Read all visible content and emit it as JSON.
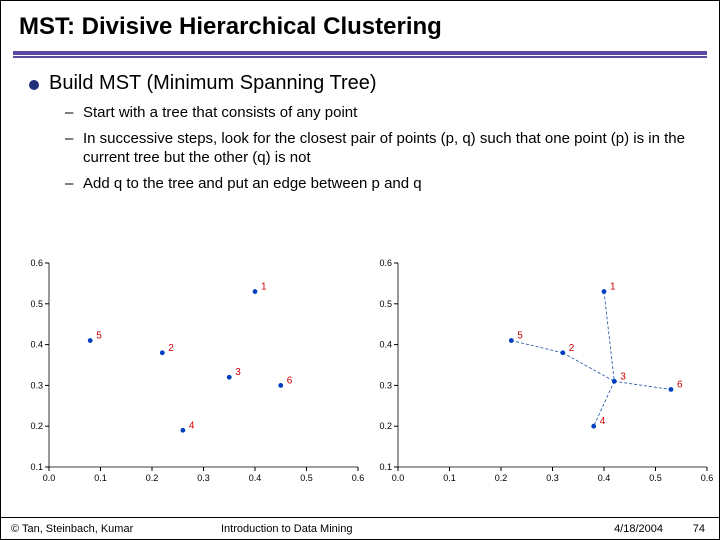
{
  "title": "MST: Divisive Hierarchical Clustering",
  "main_bullet": "Build MST (Minimum Spanning Tree)",
  "sub_bullets": [
    "Start with a tree that consists of any point",
    "In successive steps, look for the closest pair of points (p, q)  such that one point (p) is in the current tree but the other (q) is not",
    "Add q to the tree and put an edge between p and q"
  ],
  "chart_data": [
    {
      "type": "scatter",
      "title": "",
      "xlabel": "",
      "ylabel": "",
      "xlim": [
        0,
        0.6
      ],
      "ylim": [
        0.1,
        0.6
      ],
      "xticks": [
        0,
        0.1,
        0.2,
        0.3,
        0.4,
        0.5,
        0.6
      ],
      "yticks": [
        0.1,
        0.2,
        0.3,
        0.4,
        0.5,
        0.6
      ],
      "series": [
        {
          "name": "points",
          "points": [
            {
              "label": "1",
              "x": 0.4,
              "y": 0.53
            },
            {
              "label": "2",
              "x": 0.22,
              "y": 0.38
            },
            {
              "label": "3",
              "x": 0.35,
              "y": 0.32
            },
            {
              "label": "4",
              "x": 0.26,
              "y": 0.19
            },
            {
              "label": "5",
              "x": 0.08,
              "y": 0.41
            },
            {
              "label": "6",
              "x": 0.45,
              "y": 0.3
            }
          ]
        }
      ]
    },
    {
      "type": "scatter",
      "title": "",
      "xlabel": "",
      "ylabel": "",
      "xlim": [
        0,
        0.6
      ],
      "ylim": [
        0.1,
        0.6
      ],
      "xticks": [
        0,
        0.1,
        0.2,
        0.3,
        0.4,
        0.5,
        0.6
      ],
      "yticks": [
        0.1,
        0.2,
        0.3,
        0.4,
        0.5,
        0.6
      ],
      "series": [
        {
          "name": "points",
          "points": [
            {
              "label": "1",
              "x": 0.4,
              "y": 0.53
            },
            {
              "label": "2",
              "x": 0.32,
              "y": 0.38
            },
            {
              "label": "3",
              "x": 0.42,
              "y": 0.31
            },
            {
              "label": "4",
              "x": 0.38,
              "y": 0.2
            },
            {
              "label": "5",
              "x": 0.22,
              "y": 0.41
            },
            {
              "label": "6",
              "x": 0.53,
              "y": 0.29
            }
          ]
        }
      ],
      "edges": [
        [
          "5",
          "2"
        ],
        [
          "2",
          "3"
        ],
        [
          "3",
          "6"
        ],
        [
          "3",
          "4"
        ],
        [
          "1",
          "3"
        ]
      ]
    }
  ],
  "footer": {
    "copyright": "© Tan, Steinbach, Kumar",
    "center": "Introduction to Data Mining",
    "date": "4/18/2004",
    "page": "74"
  }
}
